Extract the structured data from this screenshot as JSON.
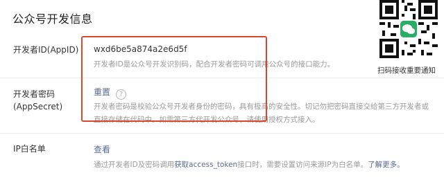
{
  "page": {
    "title": "公众号开发信息"
  },
  "appid": {
    "label": "开发者ID(AppID)",
    "value": "wxd6be5a874a2e6d5f",
    "desc": "开发者ID是公众号开发识别码，配合开发者密码可调用公众号的接口能力。"
  },
  "appsecret": {
    "label_line1": "开发者密码",
    "label_line2": "(AppSecret)",
    "reset_link": "重置",
    "help_icon": "?",
    "desc_line1": "开发者密码是校验公众号开发者身份的密码，具有极高的安全性。切记勿把密码直接交给第三方开发者或",
    "desc_line2": "直接存储在代码中。如需第三方代开发公众号，请使用授权方式接入。"
  },
  "ip_whitelist": {
    "label": "IP白名单",
    "view_link": "查看",
    "desc_before": "通过开发者ID及密码调用",
    "desc_strong": "获取access_token",
    "desc_after": "接口时，需要设置访问来源IP为白名单。",
    "learn_more": "了解更多。"
  },
  "qr": {
    "caption": "扫码接收重要通知",
    "icon": "wechat-qr-code"
  },
  "colors": {
    "highlight": "#d9482b",
    "link": "#576b95",
    "desc": "#9a9a9a"
  }
}
